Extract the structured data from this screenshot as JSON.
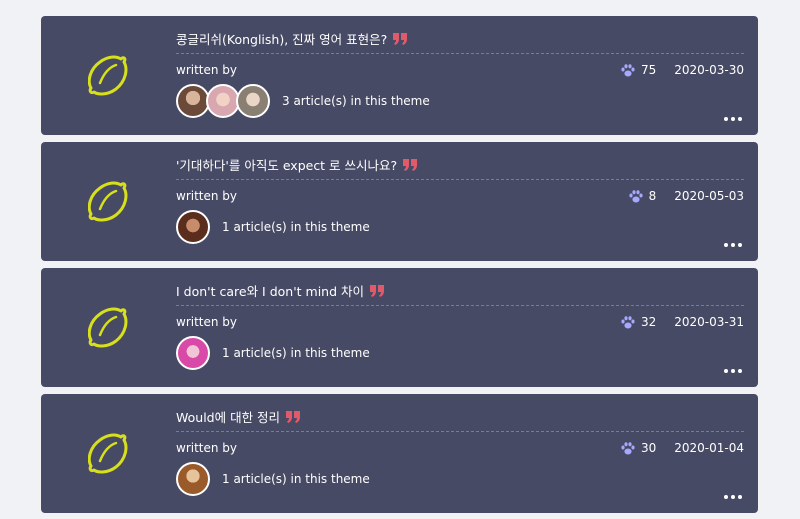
{
  "colors": {
    "card_bg": "#474a65",
    "lemon": "#d7e01b",
    "quote": "#e05a6a",
    "paw": "#a7a9ff",
    "divider": "#d25a5a"
  },
  "labels": {
    "written_by": "written by"
  },
  "cards": [
    {
      "title": "콩글리쉬(Konglish), 진짜 영어 표현은?",
      "likes": "75",
      "date": "2020-03-30",
      "article_count": "3 article(s) in this theme",
      "avatars": [
        "#6b4a3a",
        "#d9a7b0",
        "#c8c2b8"
      ]
    },
    {
      "title": "'기대하다'를 아직도 expect 로 쓰시나요?",
      "likes": "8",
      "date": "2020-05-03",
      "article_count": "1 article(s) in this theme",
      "avatars": [
        "#8a4a2c"
      ]
    },
    {
      "title": "I don't care와 I don't mind 차이",
      "likes": "32",
      "date": "2020-03-31",
      "article_count": "1 article(s) in this theme",
      "avatars": [
        "#d94aa8"
      ]
    },
    {
      "title": "Would에 대한 정리",
      "likes": "30",
      "date": "2020-01-04",
      "article_count": "1 article(s) in this theme",
      "avatars": [
        "#b8733a"
      ]
    }
  ]
}
